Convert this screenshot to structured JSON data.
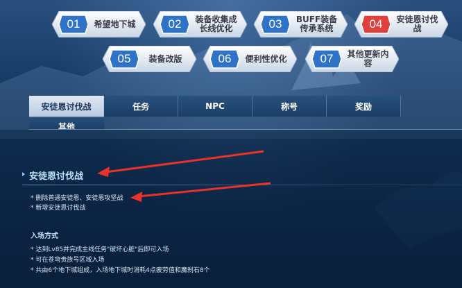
{
  "nav_items": [
    {
      "num": "01",
      "label": "希望地下城",
      "active": false
    },
    {
      "num": "02",
      "label": "装备收集成\n长线优化",
      "active": false
    },
    {
      "num": "03",
      "label": "BUFF装备\n传承系统",
      "active": false
    },
    {
      "num": "04",
      "label": "安徒恩讨伐战",
      "active": true
    },
    {
      "num": "05",
      "label": "装备改版",
      "active": false
    },
    {
      "num": "06",
      "label": "便利性优化",
      "active": false
    },
    {
      "num": "07",
      "label": "其他更新内容",
      "active": false
    }
  ],
  "tabs": [
    "安徒恩讨伐战",
    "任务",
    "NPC",
    "称号",
    "奖励",
    "其他"
  ],
  "section": {
    "title": "安徒恩讨伐战",
    "bullets": [
      "* 删除普通安徒恩、安徒恩攻坚战",
      "* 新增安徒恩讨伐战"
    ],
    "subhead": "入场方式",
    "entry_bullets": [
      "* 达到Lv85并完成主线任务\"破坏心脏\"后即可入场",
      "* 可在苍穹贵族号区域入场",
      "* 共由6个地下城组成，入场地下城时消耗4点疲劳值和魔刹石8个"
    ]
  },
  "colors": {
    "active_num": "#e0403c",
    "inactive_num": "#2f73c9",
    "arrow": "#e8322a"
  }
}
